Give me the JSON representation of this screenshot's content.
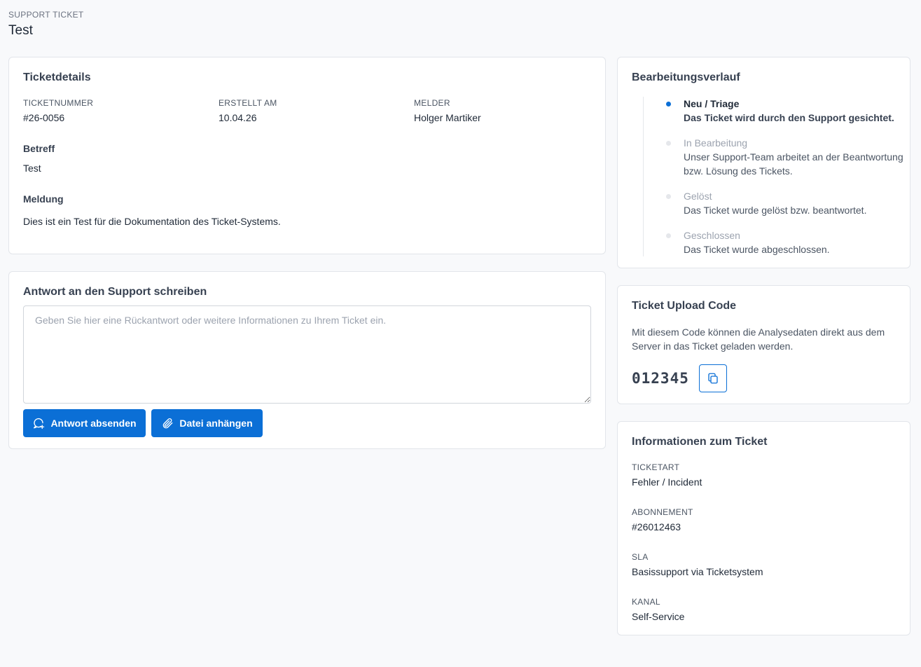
{
  "header": {
    "eyebrow": "SUPPORT TICKET",
    "title": "Test"
  },
  "details": {
    "title": "Ticketdetails",
    "ticketnummer_label": "TICKETNUMMER",
    "ticketnummer_value": "#26-0056",
    "erstellt_label": "ERSTELLT AM",
    "erstellt_value": "10.04.26",
    "melder_label": "MELDER",
    "melder_value": "Holger Martiker",
    "betreff_label": "Betreff",
    "betreff_value": "Test",
    "meldung_label": "Meldung",
    "meldung_value": "Dies ist ein Test für die Dokumentation des Ticket-Systems."
  },
  "reply": {
    "title": "Antwort an den Support schreiben",
    "placeholder": "Geben Sie hier eine Rückantwort oder weitere Informationen zu Ihrem Ticket ein.",
    "value": "",
    "send_label": "Antwort absenden",
    "attach_label": "Datei anhängen"
  },
  "history": {
    "title": "Bearbeitungsverlauf",
    "steps": [
      {
        "title": "Neu / Triage",
        "desc": "Das Ticket wird durch den Support gesichtet.",
        "active": true
      },
      {
        "title": "In Bearbeitung",
        "desc": "Unser Support-Team arbeitet an der Beantwortung bzw. Lösung des Tickets.",
        "active": false
      },
      {
        "title": "Gelöst",
        "desc": "Das Ticket wurde gelöst bzw. beantwortet.",
        "active": false
      },
      {
        "title": "Geschlossen",
        "desc": "Das Ticket wurde abgeschlossen.",
        "active": false
      }
    ]
  },
  "upload": {
    "title": "Ticket Upload Code",
    "desc": "Mit diesem Code können die Analysedaten direkt aus dem Server in das Ticket geladen werden.",
    "code": "012345"
  },
  "info": {
    "title": "Informationen zum Ticket",
    "fields": [
      {
        "label": "TICKETART",
        "value": "Fehler / Incident"
      },
      {
        "label": "ABONNEMENT",
        "value": "#26012463"
      },
      {
        "label": "SLA",
        "value": "Basissupport via Ticketsystem"
      },
      {
        "label": "KANAL",
        "value": "Self-Service"
      }
    ]
  },
  "colors": {
    "accent": "#0b6fd6",
    "background": "#f8f9fb",
    "card_border": "#e2e5ea"
  },
  "icons": {
    "send": "chat-plus-icon",
    "attach": "paperclip-icon",
    "copy": "copy-icon"
  }
}
